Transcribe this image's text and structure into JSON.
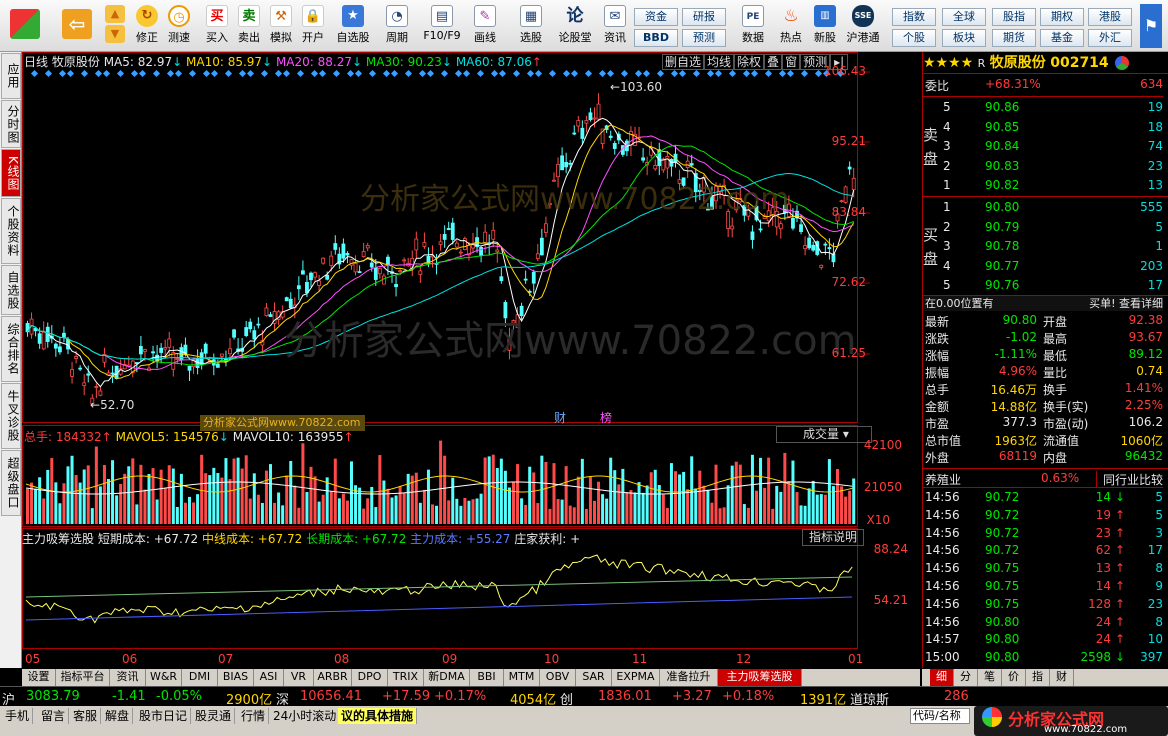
{
  "toolbar": {
    "buttons": [
      "买入",
      "卖出",
      "模拟",
      "开户",
      "自选股",
      "周期",
      "F10/F9",
      "画线",
      "选股",
      "论股堂",
      "资讯",
      "数据",
      "热点",
      "新股",
      "沪港通"
    ],
    "nav": [
      "修正",
      "测速"
    ],
    "small": [
      "资金",
      "研报",
      "BBD",
      "预测",
      "指数",
      "全球",
      "股指",
      "期权",
      "港股",
      "个股",
      "板块",
      "期货",
      "基金",
      "外汇"
    ]
  },
  "lefttabs": [
    "应用",
    "分时图",
    "K线图",
    "个股资料",
    "自选股",
    "综合排名",
    "牛叉诊股",
    "超级盘口"
  ],
  "header": {
    "period": "日线",
    "name": "牧原股份",
    "ma5": "MA5: 82.97",
    "ma10": "MA10: 85.97",
    "ma20": "MA20: 88.27",
    "ma30": "MA30: 90.23",
    "ma60": "MA60: 87.06",
    "buttons": [
      "删自选",
      "均线",
      "除权",
      "叠",
      "窗",
      "预测"
    ]
  },
  "price": {
    "axis": [
      "106.43",
      "95.21",
      "83.84",
      "72.62",
      "61.25"
    ],
    "high_label": "103.60",
    "low_label": "52.70",
    "markers": [
      "财",
      "榜"
    ],
    "watermark": "分析家公式网www.70822.com",
    "watermark2": "分析家公式网www.70822.com"
  },
  "volume": {
    "total": "总手: 184332",
    "mavol5": "MAVOL5: 154576",
    "mavol10": "MAVOL10: 163955",
    "select": "成交量",
    "axis": [
      "42100",
      "21050",
      "X10"
    ]
  },
  "indicator": {
    "name": "主力吸筹选股",
    "short": "短期成本: +67.72",
    "mid": "中线成本: +67.72",
    "long": "长期成本: +67.72",
    "main": "主力成本: +55.27",
    "dealer": "庄家获利: +",
    "explain": "指标说明",
    "axis": [
      "88.24",
      "54.21"
    ]
  },
  "xaxis": [
    "05",
    "06",
    "07",
    "08",
    "09",
    "10",
    "11",
    "12",
    "01"
  ],
  "bottomtabs": [
    "设置",
    "指标平台",
    "资讯",
    "W&R",
    "DMI",
    "BIAS",
    "ASI",
    "VR",
    "ARBR",
    "DPO",
    "TRIX",
    "新DMA",
    "BBI",
    "MTM",
    "OBV",
    "SAR",
    "EXPMA",
    "准备拉升",
    "主力吸筹选股"
  ],
  "quote": {
    "stars": "★★★★",
    "flag": "R",
    "name": "牧原股份",
    "code": "002714",
    "webi_label": "委比",
    "webi": "+68.31%",
    "webi_v": "634",
    "sell": [
      {
        "n": "5",
        "p": "90.86",
        "v": "19"
      },
      {
        "n": "4",
        "p": "90.85",
        "v": "18"
      },
      {
        "n": "3",
        "p": "90.84",
        "v": "74"
      },
      {
        "n": "2",
        "p": "90.83",
        "v": "23"
      },
      {
        "n": "1",
        "p": "90.82",
        "v": "13"
      }
    ],
    "buy": [
      {
        "n": "1",
        "p": "90.80",
        "v": "555"
      },
      {
        "n": "2",
        "p": "90.79",
        "v": "5"
      },
      {
        "n": "3",
        "p": "90.78",
        "v": "1"
      },
      {
        "n": "4",
        "p": "90.77",
        "v": "203"
      },
      {
        "n": "5",
        "p": "90.76",
        "v": "17"
      }
    ],
    "sell_label": "卖盘",
    "buy_label": "买盘",
    "pos": "在0.00位置有",
    "detail": "买单! 查看详细",
    "stats": [
      [
        "最新",
        "90.80",
        "开盘",
        "92.38"
      ],
      [
        "涨跌",
        "-1.02",
        "最高",
        "93.67"
      ],
      [
        "涨幅",
        "-1.11%",
        "最低",
        "89.12"
      ],
      [
        "振幅",
        "4.96%",
        "量比",
        "0.74"
      ],
      [
        "总手",
        "16.46万",
        "换手",
        "1.41%"
      ],
      [
        "金额",
        "14.88亿",
        "换手(实)",
        "2.25%"
      ],
      [
        "市盈",
        "377.3",
        "市盈(动)",
        "106.2"
      ],
      [
        "总市值",
        "1963亿",
        "流通值",
        "1060亿"
      ],
      [
        "外盘",
        "68119",
        "内盘",
        "96432"
      ]
    ],
    "industry": "养殖业",
    "ind_pct": "0.63%",
    "compare": "同行业比较",
    "ticks": [
      [
        "14:56",
        "90.72",
        "14",
        "↓",
        "5"
      ],
      [
        "14:56",
        "90.72",
        "19",
        "↑",
        "5"
      ],
      [
        "14:56",
        "90.72",
        "23",
        "↑",
        "3"
      ],
      [
        "14:56",
        "90.72",
        "62",
        "↑",
        "17"
      ],
      [
        "14:56",
        "90.75",
        "13",
        "↑",
        "8"
      ],
      [
        "14:56",
        "90.75",
        "14",
        "↑",
        "9"
      ],
      [
        "14:56",
        "90.75",
        "128",
        "↑",
        "23"
      ],
      [
        "14:56",
        "90.80",
        "24",
        "↑",
        "8"
      ],
      [
        "14:57",
        "90.80",
        "24",
        "↑",
        "10"
      ],
      [
        "15:00",
        "90.80",
        "2598",
        "↓",
        "397"
      ]
    ]
  },
  "rbtabs": [
    "细",
    "分",
    "笔",
    "价",
    "指",
    "财"
  ],
  "status": {
    "sh": "沪",
    "sh_v": "3083.79",
    "sh_c": "-1.41",
    "sh_p": "-0.05%",
    "sh_amt": "2900亿",
    "sz": "深",
    "sz_v": "10656.41",
    "sz_c": "+17.59",
    "sz_p": "+0.17%",
    "sz_amt": "4054亿",
    "cy": "创",
    "cy_v": "1836.01",
    "cy_c": "+3.27",
    "cy_p": "+0.18%",
    "cy_amt": "1391亿",
    "dj": "道琼斯",
    "dj_v": "286"
  },
  "status2": [
    "手机",
    "留言",
    "客服",
    "解盘",
    "股市日记",
    "股灵通",
    "行情",
    "24小时滚动",
    "议的具体措施"
  ],
  "code_input": "代码/名称",
  "logo": "分析家公式网",
  "logo_url": "www.70822.com"
}
